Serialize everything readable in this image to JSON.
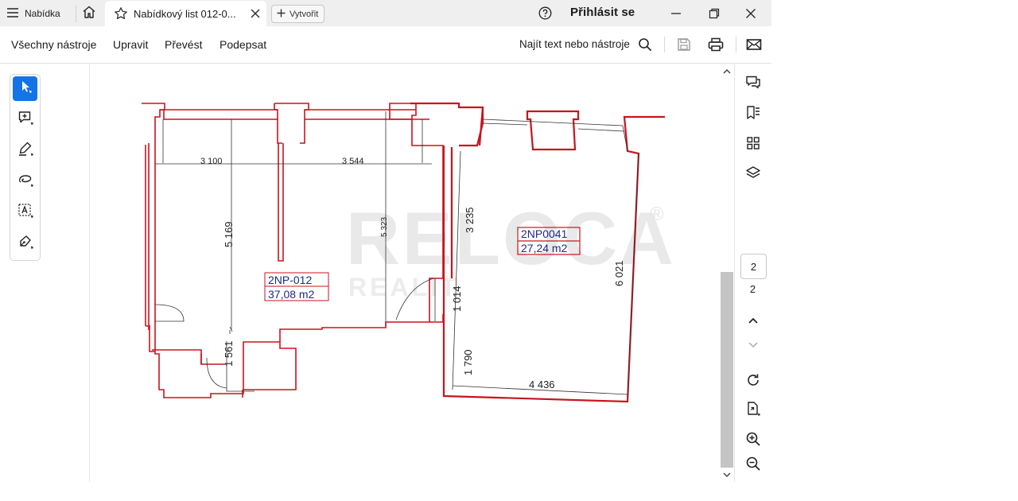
{
  "titlebar": {
    "menu_label": "Nabídka",
    "tab_title": "Nabídkový list 012-0...",
    "new_label": "Vytvořit",
    "signin_label": "Přihlásit se"
  },
  "toolbar": {
    "all_tools": "Všechny nástroje",
    "edit": "Upravit",
    "convert": "Převést",
    "sign": "Podepsat",
    "find": "Najít text nebo nástroje"
  },
  "colors": {
    "accent": "#1473e6",
    "wall_red": "#c8141e",
    "room_label_blue": "#1e2a8c",
    "watermark": "#e9e9e9"
  },
  "document": {
    "watermark_main": "RELOCA",
    "watermark_mark": "®",
    "watermark_sub": "REALIT",
    "room1": {
      "code": "2NP-012",
      "area": "37,08 m2"
    },
    "room2": {
      "code": "2NP0041",
      "area": "27,24 m2"
    },
    "dimensions": {
      "d3100": "3 100",
      "d3544": "3 544",
      "d5169": "5 169",
      "d5323": "5 323",
      "d3235": "3 235",
      "d6021": "6 021",
      "d1014": "1 014",
      "d1561": "1 561",
      "d1790": "1 790",
      "d4436": "4 436"
    }
  },
  "pagination": {
    "current": "2",
    "total": "2"
  },
  "icons": {
    "titlebar": [
      "hamburger-icon",
      "home-icon",
      "star-icon",
      "close-icon",
      "plus-icon",
      "help-icon",
      "minimize-icon",
      "restore-icon",
      "window-close-icon"
    ],
    "toolbar": [
      "search-icon",
      "save-icon",
      "print-icon",
      "mail-icon"
    ],
    "tools": [
      "select-cursor-icon",
      "add-comment-icon",
      "highlight-pen-icon",
      "lasso-draw-icon",
      "text-select-icon",
      "fill-sign-icon"
    ],
    "right_panel": [
      "comments-icon",
      "bookmarks-icon",
      "thumbnails-icon",
      "layers-icon",
      "page-up-icon",
      "page-down-icon",
      "rotate-icon",
      "extract-page-icon",
      "zoom-in-icon",
      "zoom-out-icon"
    ]
  }
}
